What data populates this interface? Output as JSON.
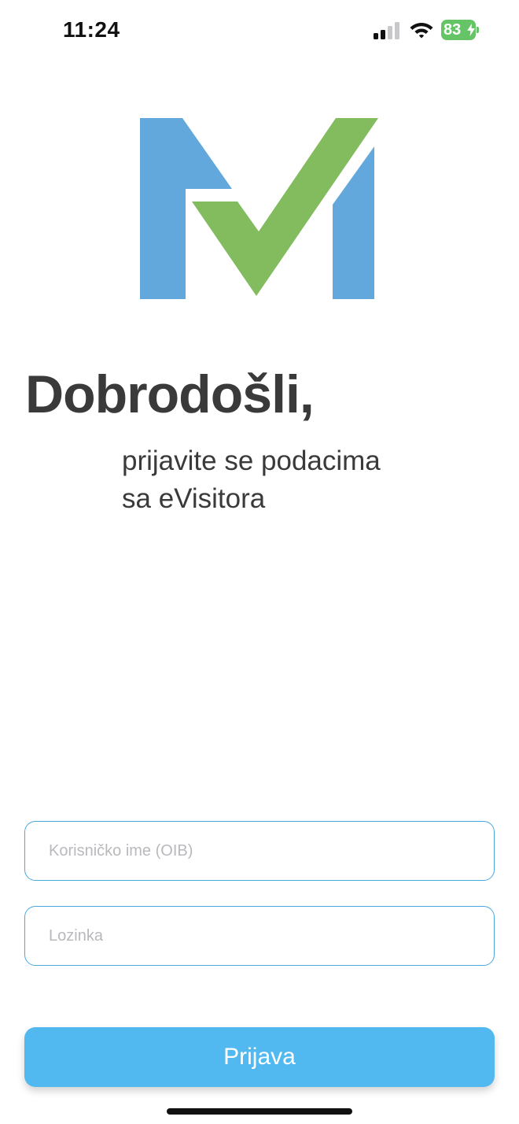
{
  "status_bar": {
    "time": "11:24",
    "battery_percent": "83",
    "battery_color": "#64c466",
    "icons": [
      "signal-icon",
      "wifi-icon",
      "battery-icon",
      "charging-bolt-icon"
    ]
  },
  "logo": {
    "icon": "m-checkmark-logo",
    "colors": {
      "blue": "#62a8dc",
      "green": "#82bc5e"
    }
  },
  "welcome": {
    "title": "Dobrodošli,",
    "subtitle_line1": "prijavite se podacima",
    "subtitle_line2": "sa eVisitora"
  },
  "form": {
    "username_placeholder": "Korisničko ime (OIB)",
    "password_placeholder": "Lozinka",
    "submit_label": "Prijava",
    "accent_color": "#4aa8e0",
    "button_color": "#51b9f0"
  }
}
